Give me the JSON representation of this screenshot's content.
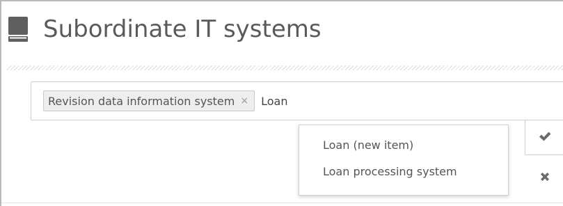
{
  "header": {
    "title": "Subordinate IT systems",
    "icon": "book-icon"
  },
  "tag_input": {
    "tags": [
      {
        "label": "Revision data information system",
        "remove_label": "×"
      }
    ],
    "typed_value": "Loan"
  },
  "dropdown": {
    "items": [
      {
        "label": "Loan (new item)"
      },
      {
        "label": "Loan processing system"
      }
    ]
  },
  "actions": {
    "confirm_icon": "checkmark-icon",
    "cancel_icon": "close-icon"
  },
  "colors": {
    "title": "#5a5a5a",
    "tag_bg": "#eeeeee",
    "icon": "#666666"
  }
}
